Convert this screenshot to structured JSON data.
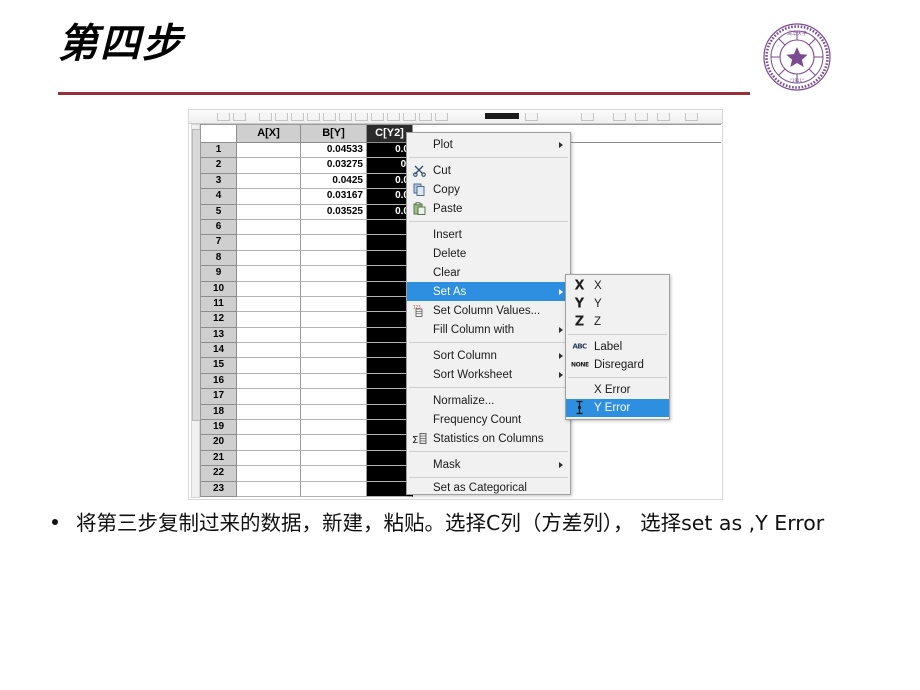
{
  "slide": {
    "title": "第四步",
    "rule_color": "#96313b",
    "bullet_text": "将第三步复制过来的数据，新建，粘贴。选择C列（方差列）， 选择set as ,Y Error"
  },
  "seal": {
    "name": "university-seal",
    "color": "#7a4b8f",
    "top_text": "清华大学",
    "year": "1911"
  },
  "worksheet": {
    "columns": [
      {
        "key": "row",
        "label": ""
      },
      {
        "key": "a",
        "label": "A[X]"
      },
      {
        "key": "b",
        "label": "B[Y]"
      },
      {
        "key": "c",
        "label": "C[Y2]",
        "selected": true
      }
    ],
    "rows": [
      {
        "row": "1",
        "a": "",
        "b": "0.04533",
        "c": "0.0"
      },
      {
        "row": "2",
        "a": "",
        "b": "0.03275",
        "c": "0."
      },
      {
        "row": "3",
        "a": "",
        "b": "0.0425",
        "c": "0.0"
      },
      {
        "row": "4",
        "a": "",
        "b": "0.03167",
        "c": "0.0"
      },
      {
        "row": "5",
        "a": "",
        "b": "0.03525",
        "c": "0.0"
      },
      {
        "row": "6",
        "a": "",
        "b": "",
        "c": ""
      },
      {
        "row": "7",
        "a": "",
        "b": "",
        "c": ""
      },
      {
        "row": "8",
        "a": "",
        "b": "",
        "c": ""
      },
      {
        "row": "9",
        "a": "",
        "b": "",
        "c": ""
      },
      {
        "row": "10",
        "a": "",
        "b": "",
        "c": ""
      },
      {
        "row": "11",
        "a": "",
        "b": "",
        "c": ""
      },
      {
        "row": "12",
        "a": "",
        "b": "",
        "c": ""
      },
      {
        "row": "13",
        "a": "",
        "b": "",
        "c": ""
      },
      {
        "row": "14",
        "a": "",
        "b": "",
        "c": ""
      },
      {
        "row": "15",
        "a": "",
        "b": "",
        "c": ""
      },
      {
        "row": "16",
        "a": "",
        "b": "",
        "c": ""
      },
      {
        "row": "17",
        "a": "",
        "b": "",
        "c": ""
      },
      {
        "row": "18",
        "a": "",
        "b": "",
        "c": ""
      },
      {
        "row": "19",
        "a": "",
        "b": "",
        "c": ""
      },
      {
        "row": "20",
        "a": "",
        "b": "",
        "c": ""
      },
      {
        "row": "21",
        "a": "",
        "b": "",
        "c": ""
      },
      {
        "row": "22",
        "a": "",
        "b": "",
        "c": ""
      },
      {
        "row": "23",
        "a": "",
        "b": "",
        "c": ""
      }
    ]
  },
  "context_menu": {
    "highlight_color": "#2e8fe0",
    "items": [
      {
        "label": "Plot",
        "icon": "",
        "submenu": true,
        "selected": false,
        "separator_after": true
      },
      {
        "label": "Cut",
        "icon": "scissors-icon",
        "submenu": false,
        "selected": false
      },
      {
        "label": "Copy",
        "icon": "copy-icon",
        "submenu": false,
        "selected": false
      },
      {
        "label": "Paste",
        "icon": "paste-icon",
        "submenu": false,
        "selected": false,
        "separator_after": true
      },
      {
        "label": "Insert",
        "icon": "",
        "submenu": false,
        "selected": false
      },
      {
        "label": "Delete",
        "icon": "",
        "submenu": false,
        "selected": false
      },
      {
        "label": "Clear",
        "icon": "",
        "submenu": false,
        "selected": false
      },
      {
        "label": "Set As",
        "icon": "",
        "submenu": true,
        "selected": true
      },
      {
        "label": "Set Column Values...",
        "icon": "column-values-icon",
        "submenu": false,
        "selected": false
      },
      {
        "label": "Fill Column with",
        "icon": "",
        "submenu": true,
        "selected": false,
        "separator_after": true
      },
      {
        "label": "Sort Column",
        "icon": "",
        "submenu": true,
        "selected": false
      },
      {
        "label": "Sort Worksheet",
        "icon": "",
        "submenu": true,
        "selected": false,
        "separator_after": true
      },
      {
        "label": "Normalize...",
        "icon": "",
        "submenu": false,
        "selected": false
      },
      {
        "label": "Frequency Count",
        "icon": "",
        "submenu": false,
        "selected": false
      },
      {
        "label": "Statistics on Columns",
        "icon": "sigma-icon",
        "submenu": false,
        "selected": false,
        "separator_after": true
      },
      {
        "label": "Mask",
        "icon": "",
        "submenu": true,
        "selected": false,
        "separator_after": true
      },
      {
        "label": "Set as Categorical",
        "icon": "",
        "submenu": false,
        "selected": false,
        "clipped": true
      }
    ]
  },
  "set_as_submenu": {
    "highlight_color": "#2e8fe0",
    "items": [
      {
        "label": "X",
        "icon": "x-axis-icon",
        "glyph": "X",
        "selected": false
      },
      {
        "label": "Y",
        "icon": "y-axis-icon",
        "glyph": "Y",
        "selected": false
      },
      {
        "label": "Z",
        "icon": "z-axis-icon",
        "glyph": "Z",
        "selected": false,
        "separator_after": true
      },
      {
        "label": "Label",
        "icon": "label-icon",
        "glyph": "ABC",
        "selected": false
      },
      {
        "label": "Disregard",
        "icon": "disregard-icon",
        "glyph": "NONE",
        "selected": false,
        "separator_after": true
      },
      {
        "label": "X Error",
        "icon": "",
        "glyph": "",
        "selected": false
      },
      {
        "label": "Y Error",
        "icon": "y-error-icon",
        "glyph": "I",
        "selected": true
      }
    ]
  }
}
